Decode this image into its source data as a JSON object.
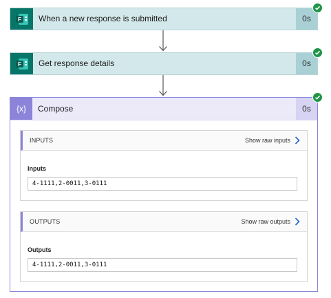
{
  "steps": [
    {
      "title": "When a new response is submitted",
      "duration": "0s",
      "icon": "forms-icon"
    },
    {
      "title": "Get response details",
      "duration": "0s",
      "icon": "forms-icon"
    }
  ],
  "compose": {
    "title": "Compose",
    "duration": "0s",
    "icon_text": "{x}",
    "inputs": {
      "heading": "INPUTS",
      "show_raw": "Show raw inputs",
      "label": "Inputs",
      "value": "4-1111,2-0011,3-0111"
    },
    "outputs": {
      "heading": "OUTPUTS",
      "show_raw": "Show raw outputs",
      "label": "Outputs",
      "value": "4-1111,2-0011,3-0111"
    }
  },
  "colors": {
    "forms_teal": "#077568",
    "step_bg": "#d3e8ea",
    "compose_accent": "#8b84d9",
    "success_green": "#1f9448"
  }
}
